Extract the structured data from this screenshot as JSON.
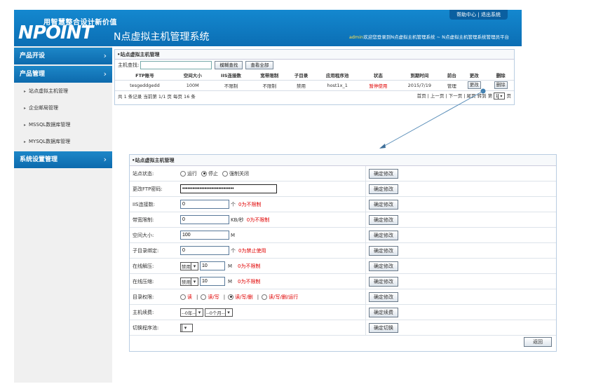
{
  "header": {
    "slogan": "用智慧整合设计新价值",
    "logo": "NPOINT",
    "system_title": "N点虚拟主机管理系统",
    "top_links": [
      "帮助中心",
      "退出系统"
    ],
    "welcome_user": "admin",
    "welcome_text": "欢迎您登录到N点虚拟主机管理系统 ~ N点虚拟主机管理系统管理员平台"
  },
  "sidebar": {
    "groups": [
      {
        "label": "产品开设"
      },
      {
        "label": "产品管理"
      }
    ],
    "sub_items": [
      "站点虚拟主机管理",
      "企业邮局管理",
      "MSSQL数据库管理",
      "MYSQL数据库管理"
    ],
    "bottom_group": "系统设置管理"
  },
  "list_panel": {
    "title": "•站点虚拟主机管理",
    "search_label": "主机查找:",
    "search_value": "",
    "search_button": "模糊查找",
    "all_button": "查看全部",
    "columns": [
      "FTP账号",
      "空间大小",
      "IIS连接数",
      "宽带限制",
      "子目录",
      "应用程序池",
      "状态",
      "到期时间",
      "前台",
      "更改",
      "删除"
    ],
    "rows": [
      {
        "account": "tesgeddgedd",
        "space": "100M",
        "iis": "不限制",
        "bandwidth": "不限制",
        "subdir": "禁用",
        "pool": "host1x_1",
        "status": "暂停使用",
        "expire": "2015/7/19",
        "front": "管理",
        "edit": "更改",
        "delete": "删除"
      }
    ],
    "summary": "共 1 条记录 当前第 1/1 页 每页 16 条",
    "pager": "首页 | 上一页 | 下一页 | 尾页  转到 第",
    "page_select": "1",
    "page_suffix": "页"
  },
  "edit_panel": {
    "title": "•站点虚拟主机管理",
    "confirm_label": "确定修改",
    "status": {
      "label": "站点状态:",
      "options": [
        "运行",
        "停止",
        "强制关闭"
      ],
      "selected": 1
    },
    "ftp_password": {
      "label": "更改FTP密码:",
      "value": "••••••••••••••••••••••••••••••"
    },
    "iis": {
      "label": "IIS连接数:",
      "value": "0",
      "unit": "个",
      "hint": "0为不限制"
    },
    "bandwidth": {
      "label": "带宽限制:",
      "value": "0",
      "unit": "KB/秒",
      "hint": "0为不限制"
    },
    "space": {
      "label": "空间大小:",
      "value": "100",
      "unit": "M"
    },
    "subdir": {
      "label": "子目录绑定:",
      "value": "0",
      "unit": "个",
      "hint": "0为禁止使用"
    },
    "online_unzip": {
      "label": "在线解压:",
      "select": "禁用",
      "value": "10",
      "unit": "M",
      "hint": "0为不限制"
    },
    "online_zip": {
      "label": "在线压缩:",
      "select": "禁用",
      "value": "10",
      "unit": "M",
      "hint": "0为不限制"
    },
    "dir_perm": {
      "label": "目录权限:",
      "options": [
        "读",
        "读/写",
        "读/写/删",
        "读/写/删/运行"
      ],
      "selected": 2
    },
    "renew": {
      "label": "主机续费:",
      "year": "--0年--",
      "month": "--0个月--",
      "button": "确定续费"
    },
    "pool_switch": {
      "label": "切换程序池:",
      "select": "",
      "button": "确定切换"
    },
    "back_button": "返回"
  },
  "colors": {
    "accent": "#0b6eb4",
    "warning": "#e00000"
  }
}
